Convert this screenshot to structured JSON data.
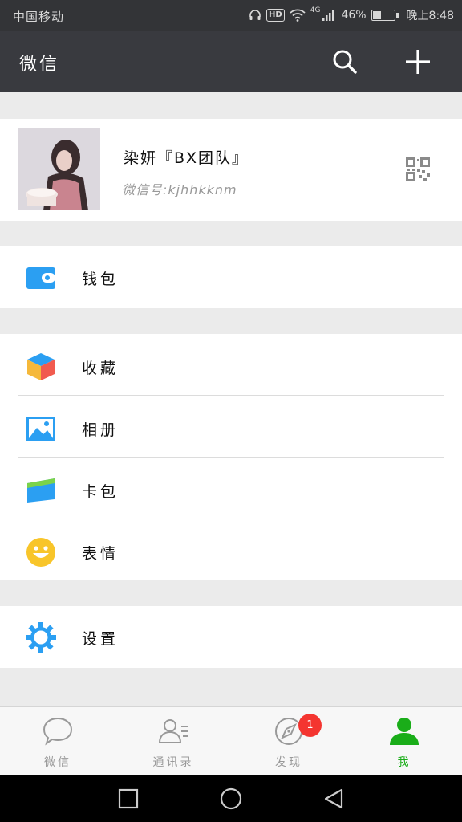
{
  "status_bar": {
    "carrier": "中国移动",
    "hd": "HD",
    "network": "4G",
    "battery_text": "46%",
    "battery_level": 0.46,
    "time": "晚上8:48"
  },
  "header": {
    "title": "微信",
    "search_icon": "search-icon",
    "add_icon": "plus-icon"
  },
  "profile": {
    "nickname": "染妍『BX团队』",
    "wechat_id": "微信号:kjhhkknm",
    "qr_icon": "qr-code-icon"
  },
  "menu": {
    "wallet": {
      "label": "钱包",
      "icon": "wallet-icon"
    },
    "favorites": {
      "label": "收藏",
      "icon": "cube-icon"
    },
    "album": {
      "label": "相册",
      "icon": "photo-icon"
    },
    "cards": {
      "label": "卡包",
      "icon": "card-icon"
    },
    "stickers": {
      "label": "表情",
      "icon": "smiley-icon"
    },
    "settings": {
      "label": "设置",
      "icon": "gear-icon"
    }
  },
  "tabs": [
    {
      "label": "微信",
      "icon": "chat-bubble-icon",
      "active": false
    },
    {
      "label": "通讯录",
      "icon": "contacts-icon",
      "active": false
    },
    {
      "label": "发现",
      "icon": "compass-icon",
      "active": false,
      "badge": "1"
    },
    {
      "label": "我",
      "icon": "person-icon",
      "active": true
    }
  ],
  "colors": {
    "header_bg": "#393a3f",
    "status_bg": "#333437",
    "accent_green": "#1aad19",
    "badge_red": "#f43530",
    "icon_blue": "#2b9ff2"
  }
}
